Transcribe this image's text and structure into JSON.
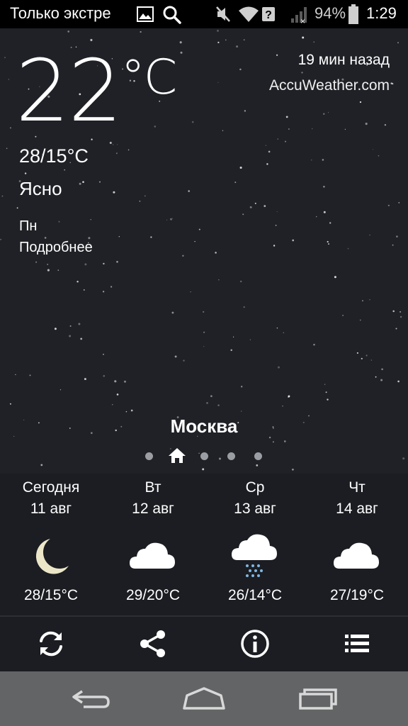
{
  "status_bar": {
    "notification_text": "Только экстре",
    "battery_percent": "94%",
    "time": "1:29",
    "icons": [
      "image-icon",
      "search-icon",
      "mute-icon",
      "wifi-icon",
      "no-sim-signal-icon",
      "battery-icon"
    ]
  },
  "weather": {
    "temperature": "22",
    "temperature_unit": "°C",
    "min_max": "28/15°C",
    "condition": "Ясно",
    "day": "Пн",
    "details_link": "Подробнее",
    "updated": "19 мин назад",
    "source": "AccuWeather.com",
    "city": "Москва",
    "page_indicator": {
      "count": 5,
      "active_index": 1,
      "active_icon": "home-icon"
    }
  },
  "forecast": [
    {
      "name": "Сегодня",
      "date": "11 авг",
      "icon": "moon-icon",
      "temps": "28/15°C"
    },
    {
      "name": "Вт",
      "date": "12 авг",
      "icon": "cloud-icon",
      "temps": "29/20°C"
    },
    {
      "name": "Ср",
      "date": "13 авг",
      "icon": "cloud-rain-icon",
      "temps": "26/14°C"
    },
    {
      "name": "Чт",
      "date": "14 авг",
      "icon": "cloud-icon",
      "temps": "27/19°C"
    }
  ],
  "toolbar": {
    "buttons": [
      "refresh-icon",
      "share-icon",
      "info-icon",
      "list-icon"
    ]
  },
  "navbar": {
    "buttons": [
      "back-icon",
      "home-icon",
      "recent-apps-icon"
    ]
  },
  "colors": {
    "background": "#1f2126",
    "forecast_bg": "#1b1d22",
    "navbar_bg": "#636466",
    "moon": "#ece6c8"
  }
}
